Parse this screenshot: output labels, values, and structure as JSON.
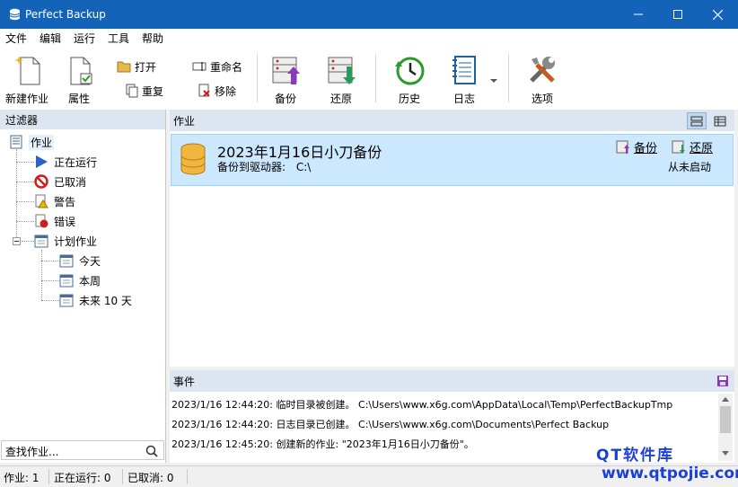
{
  "window": {
    "title": "Perfect Backup"
  },
  "menu": [
    "文件",
    "编辑",
    "运行",
    "工具",
    "帮助"
  ],
  "toolbar": {
    "new_job": "新建作业",
    "properties": "属性",
    "open": "打开",
    "duplicate": "重复",
    "rename": "重命名",
    "remove": "移除",
    "backup": "备份",
    "restore": "还原",
    "history": "历史",
    "log": "日志",
    "options": "选项"
  },
  "filter": {
    "header": "过滤器",
    "root": "作业",
    "running": "正在运行",
    "cancelled": "已取消",
    "warning": "警告",
    "error": "错误",
    "scheduled": "计划作业",
    "today": "今天",
    "this_week": "本周",
    "next_days": "未来 10 天"
  },
  "search": {
    "placeholder": "查找作业..."
  },
  "jobs": {
    "header": "作业",
    "items": [
      {
        "title": "2023年1月16日小刀备份",
        "sub_label": "备份到驱动器:",
        "sub_value": "C:\\",
        "backup": "备份",
        "restore": "还原",
        "status": "从未启动"
      }
    ]
  },
  "events": {
    "header": "事件",
    "rows": [
      {
        "time": "2023/1/16 12:44:20:",
        "text": "临时目录被创建。 C:\\Users\\www.x6g.com\\AppData\\Local\\Temp\\PerfectBackupTmp"
      },
      {
        "time": "2023/1/16 12:44:20:",
        "text": "日志目录已创建。 C:\\Users\\www.x6g.com\\Documents\\Perfect Backup"
      },
      {
        "time": "2023/1/16 12:45:20:",
        "text": "创建新的作业: \"2023年1月16日小刀备份\"。"
      }
    ]
  },
  "status": {
    "jobs": "作业: 1",
    "running": "正在运行: 0",
    "cancelled": "已取消: 0"
  },
  "watermark": {
    "line1": "QT软件库",
    "line2": "www.qtpojie.com"
  },
  "colors": {
    "titlebar": "#1363b8",
    "selection": "#cce8ff",
    "accent": "#1c3fd6"
  }
}
